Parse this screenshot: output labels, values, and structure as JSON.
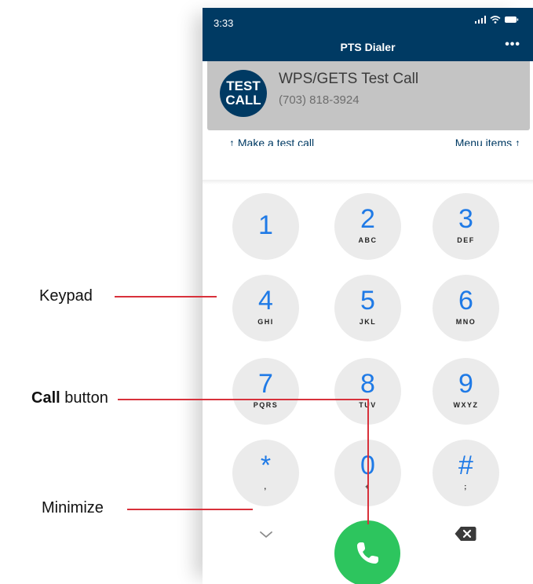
{
  "status_bar": {
    "time": "3:33"
  },
  "navbar": {
    "title": "PTS Dialer",
    "more_label": "•••"
  },
  "banner": {
    "badge_line1": "TEST",
    "badge_line2": "CALL",
    "title": "WPS/GETS Test Call",
    "phone": "(703) 818-3924"
  },
  "hints": {
    "left": "↑ Make a test call",
    "right": "Menu items ↑"
  },
  "keypad": {
    "keys": [
      {
        "digit": "1",
        "letters": ""
      },
      {
        "digit": "2",
        "letters": "ABC"
      },
      {
        "digit": "3",
        "letters": "DEF"
      },
      {
        "digit": "4",
        "letters": "GHI"
      },
      {
        "digit": "5",
        "letters": "JKL"
      },
      {
        "digit": "6",
        "letters": "MNO"
      },
      {
        "digit": "7",
        "letters": "PQRS"
      },
      {
        "digit": "8",
        "letters": "TUV"
      },
      {
        "digit": "9",
        "letters": "WXYZ"
      },
      {
        "digit": "*",
        "letters": ","
      },
      {
        "digit": "0",
        "letters": "+"
      },
      {
        "digit": "#",
        "letters": ";"
      }
    ]
  },
  "annotations": {
    "keypad": "Keypad",
    "call_bold": "Call",
    "call_rest": " button",
    "minimize": "Minimize"
  },
  "colors": {
    "navbar": "#003a63",
    "key_digit": "#1f7ae6",
    "call_button": "#2dc55e",
    "annotation_line": "#d8313b"
  },
  "icons": {
    "signal": "signal-icon",
    "wifi": "wifi-icon",
    "battery": "battery-icon",
    "minimize": "chevron-down-icon",
    "call": "phone-icon",
    "backspace": "backspace-icon"
  }
}
